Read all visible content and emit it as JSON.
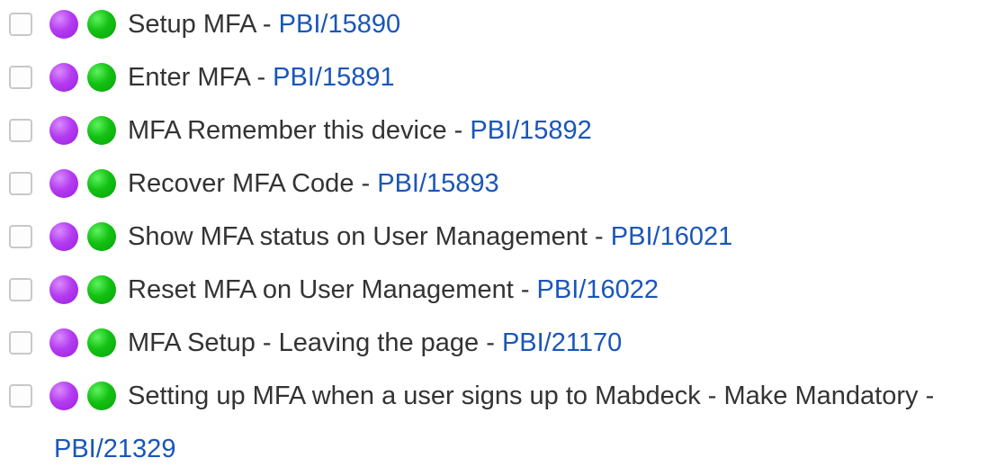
{
  "tasks": [
    {
      "title": "Setup MFA",
      "link": "PBI/15890"
    },
    {
      "title": "Enter MFA",
      "link": "PBI/15891"
    },
    {
      "title": "MFA Remember this device",
      "link": "PBI/15892"
    },
    {
      "title": "Recover MFA Code",
      "link": "PBI/15893"
    },
    {
      "title": "Show MFA status on User Management",
      "link": "PBI/16021"
    },
    {
      "title": "Reset MFA on User Management",
      "link": "PBI/16022"
    },
    {
      "title": "MFA Setup - Leaving the page",
      "link": "PBI/21170"
    },
    {
      "title": "Setting up MFA when a user signs up to Mabdeck - Make Mandatory",
      "link": "PBI/21329"
    }
  ],
  "separator": " - ",
  "colors": {
    "link": "#1a56b8",
    "text": "#333333",
    "status_purple": "#b43cf0",
    "status_green": "#13c113"
  },
  "icons": {
    "status_1": "purple-circle-icon",
    "status_2": "green-circle-icon"
  }
}
